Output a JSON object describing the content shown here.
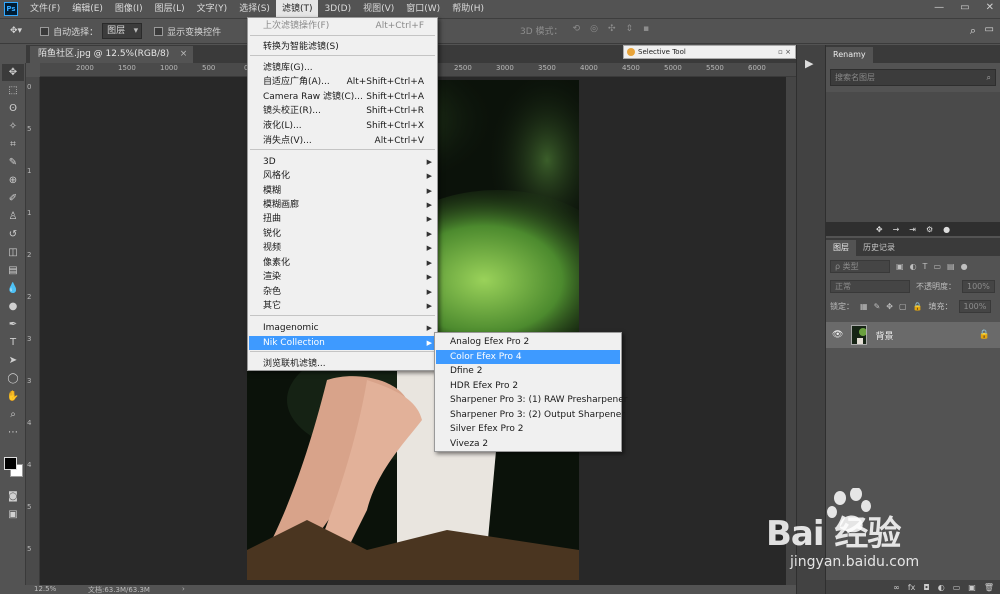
{
  "app": {
    "logo": "Ps",
    "menus": [
      "文件(F)",
      "编辑(E)",
      "图像(I)",
      "图层(L)",
      "文字(Y)",
      "选择(S)",
      "滤镜(T)",
      "3D(D)",
      "视图(V)",
      "窗口(W)",
      "帮助(H)"
    ],
    "active_menu_index": 6
  },
  "options_bar": {
    "auto_select_label": "自动选择：",
    "auto_select_value": "图层",
    "show_transform_label": "显示变换控件",
    "mode_3d_label": "3D 模式："
  },
  "document": {
    "tab_title": "陌鱼社区.jpg @ 12.5%(RGB/8)",
    "tab_close": "×",
    "ruler_labels": [
      "2000",
      "1500",
      "1000",
      "500",
      "0",
      "500",
      "1000",
      "1500",
      "2000",
      "2500",
      "3000",
      "3500",
      "4000",
      "4500",
      "5000",
      "5500",
      "6000"
    ],
    "vruler_labels": [
      "0",
      "5",
      "1",
      "1",
      "2",
      "2",
      "3",
      "3",
      "4",
      "4",
      "5",
      "5"
    ],
    "zoom": "12.5%",
    "doc_size": "文档:63.3M/63.3M",
    "status_arrow": "›"
  },
  "selective_tool": {
    "title": "Selective Tool",
    "buttons": "▫ ×"
  },
  "filter_menu": {
    "items": [
      {
        "label": "上次滤镜操作(F)",
        "shortcut": "Alt+Ctrl+F",
        "disabled": true
      },
      {
        "label": "转换为智能滤镜(S)",
        "shortcut": ""
      },
      {
        "label": "滤镜库(G)...",
        "shortcut": ""
      },
      {
        "label": "自适应广角(A)...",
        "shortcut": "Alt+Shift+Ctrl+A"
      },
      {
        "label": "Camera Raw 滤镜(C)...",
        "shortcut": "Shift+Ctrl+A"
      },
      {
        "label": "镜头校正(R)...",
        "shortcut": "Shift+Ctrl+R"
      },
      {
        "label": "液化(L)...",
        "shortcut": "Shift+Ctrl+X"
      },
      {
        "label": "消失点(V)...",
        "shortcut": "Alt+Ctrl+V"
      },
      {
        "label": "3D",
        "submenu": true
      },
      {
        "label": "风格化",
        "submenu": true
      },
      {
        "label": "模糊",
        "submenu": true
      },
      {
        "label": "模糊画廊",
        "submenu": true
      },
      {
        "label": "扭曲",
        "submenu": true
      },
      {
        "label": "锐化",
        "submenu": true
      },
      {
        "label": "视频",
        "submenu": true
      },
      {
        "label": "像素化",
        "submenu": true
      },
      {
        "label": "渲染",
        "submenu": true
      },
      {
        "label": "杂色",
        "submenu": true
      },
      {
        "label": "其它",
        "submenu": true
      },
      {
        "label": "Imagenomic",
        "submenu": true
      },
      {
        "label": "Nik Collection",
        "submenu": true,
        "highlighted": true
      },
      {
        "label": "浏览联机滤镜...",
        "shortcut": ""
      }
    ]
  },
  "nik_menu": {
    "items": [
      {
        "label": "Analog Efex Pro 2"
      },
      {
        "label": "Color Efex Pro 4",
        "highlighted": true
      },
      {
        "label": "Dfine 2"
      },
      {
        "label": "HDR Efex Pro 2"
      },
      {
        "label": "Sharpener Pro 3: (1) RAW Presharpener"
      },
      {
        "label": "Sharpener Pro 3: (2) Output Sharpener"
      },
      {
        "label": "Silver Efex Pro 2"
      },
      {
        "label": "Viveza 2"
      }
    ]
  },
  "renamy_panel": {
    "tab": "Renamy",
    "search_placeholder": "搜索名图层",
    "search_icon": "⌕",
    "icons": [
      "✥",
      "→",
      "⇥",
      "⚙",
      "●"
    ]
  },
  "layers_panel": {
    "tabs": [
      "图层",
      "历史记录"
    ],
    "kind_label": "ρ 类型",
    "blend_mode": "正常",
    "opacity_label": "不透明度：",
    "opacity_value": "100%",
    "lock_label": "锁定：",
    "fill_label": "填充：",
    "fill_value": "100%",
    "layer_name": "背景",
    "footer_icons": [
      "∞",
      "fx",
      "◘",
      "◐",
      "▭",
      "▣",
      "🗑"
    ]
  },
  "watermark": {
    "brand": "Bai 经验",
    "url": "jingyan.baidu.com"
  },
  "colors": {
    "ui_bg": "#535353",
    "canvas_bg": "#282828",
    "menu_bg": "#f0f0f0",
    "highlight": "#3e9aff",
    "ps_blue": "#31a8ff"
  }
}
